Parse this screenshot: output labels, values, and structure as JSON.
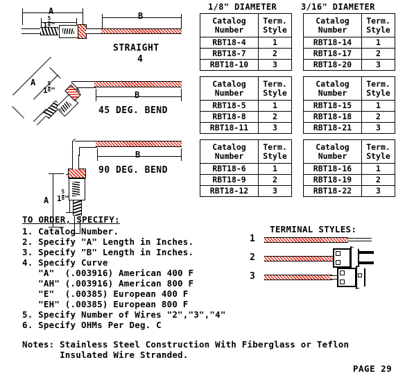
{
  "tables": {
    "column_titles": [
      "1/8\" DIAMETER",
      "3/16\" DIAMETER"
    ],
    "headers": {
      "col1_line1": "Catalog",
      "col1_line2": "Number",
      "col2_line1": "Term.",
      "col2_line2": "Style"
    },
    "groups": [
      {
        "diameter": "1/8\" DIAMETER",
        "blocks": [
          {
            "rows": [
              {
                "catalog": "RBT18-4",
                "style": "1"
              },
              {
                "catalog": "RBT18-7",
                "style": "2"
              },
              {
                "catalog": "RBT18-10",
                "style": "3"
              }
            ]
          },
          {
            "rows": [
              {
                "catalog": "RBT18-5",
                "style": "1"
              },
              {
                "catalog": "RBT18-8",
                "style": "2"
              },
              {
                "catalog": "RBT18-11",
                "style": "3"
              }
            ]
          },
          {
            "rows": [
              {
                "catalog": "RBT18-6",
                "style": "1"
              },
              {
                "catalog": "RBT18-9",
                "style": "2"
              },
              {
                "catalog": "RBT18-12",
                "style": "3"
              }
            ]
          }
        ]
      },
      {
        "diameter": "3/16\" DIAMETER",
        "blocks": [
          {
            "rows": [
              {
                "catalog": "RBT18-14",
                "style": "1"
              },
              {
                "catalog": "RBT18-17",
                "style": "2"
              },
              {
                "catalog": "RBT18-20",
                "style": "3"
              }
            ]
          },
          {
            "rows": [
              {
                "catalog": "RBT18-15",
                "style": "1"
              },
              {
                "catalog": "RBT18-18",
                "style": "2"
              },
              {
                "catalog": "RBT18-21",
                "style": "3"
              }
            ]
          },
          {
            "rows": [
              {
                "catalog": "RBT18-16",
                "style": "1"
              },
              {
                "catalog": "RBT18-19",
                "style": "2"
              },
              {
                "catalog": "RBT18-22",
                "style": "3"
              }
            ]
          }
        ]
      }
    ]
  },
  "diagrams": {
    "straight": {
      "caption": "STRAIGHT",
      "dim_a": "A",
      "dim_b": "B",
      "dim_insert_whole": "1",
      "dim_insert_num": "5",
      "dim_insert_den": "8",
      "dim_insert_unit": "\"",
      "stray_number": "4"
    },
    "bend45": {
      "caption": "45 DEG. BEND",
      "dim_a": "A",
      "dim_b": "B",
      "dim_insert_whole": "1",
      "dim_insert_num": "5",
      "dim_insert_den": "8",
      "dim_insert_unit": "\""
    },
    "bend90": {
      "caption": "90 DEG. BEND",
      "dim_a": "A",
      "dim_b": "B",
      "dim_insert_whole": "1",
      "dim_insert_num": "5",
      "dim_insert_den": "8",
      "dim_insert_unit": "\""
    }
  },
  "order": {
    "heading": "TO ORDER, SPECIFY:",
    "items": [
      "1. Catalog Number.",
      "2. Specify \"A\" Length in Inches.",
      "3. Specify \"B\" Length in Inches.",
      "4. Specify Curve",
      "   \"A\"  (.003916) American 400 F",
      "   \"AH\" (.003916) American 800 F",
      "   \"E\"  (.00385) European 400 F",
      "   \"EH\" (.00385) European 800 F",
      "5. Specify Number of Wires \"2\",\"3\",\"4\"",
      "6. Specify OHMs Per Deg. C"
    ]
  },
  "terminal_styles": {
    "title": "TERMINAL STYLES:",
    "items": [
      {
        "number": "1",
        "description": "bare-lead-wire"
      },
      {
        "number": "2",
        "description": "male-plug-connector"
      },
      {
        "number": "3",
        "description": "female-jack-connector"
      }
    ]
  },
  "notes": {
    "line1": "Notes: Stainless Steel Construction With Fiberglass or Teflon",
    "line2": "       Insulated Wire Stranded."
  },
  "footer": {
    "page": "PAGE 29"
  },
  "colors": {
    "wire_red": "#e03020",
    "ink": "#000000",
    "paper": "#ffffff"
  }
}
